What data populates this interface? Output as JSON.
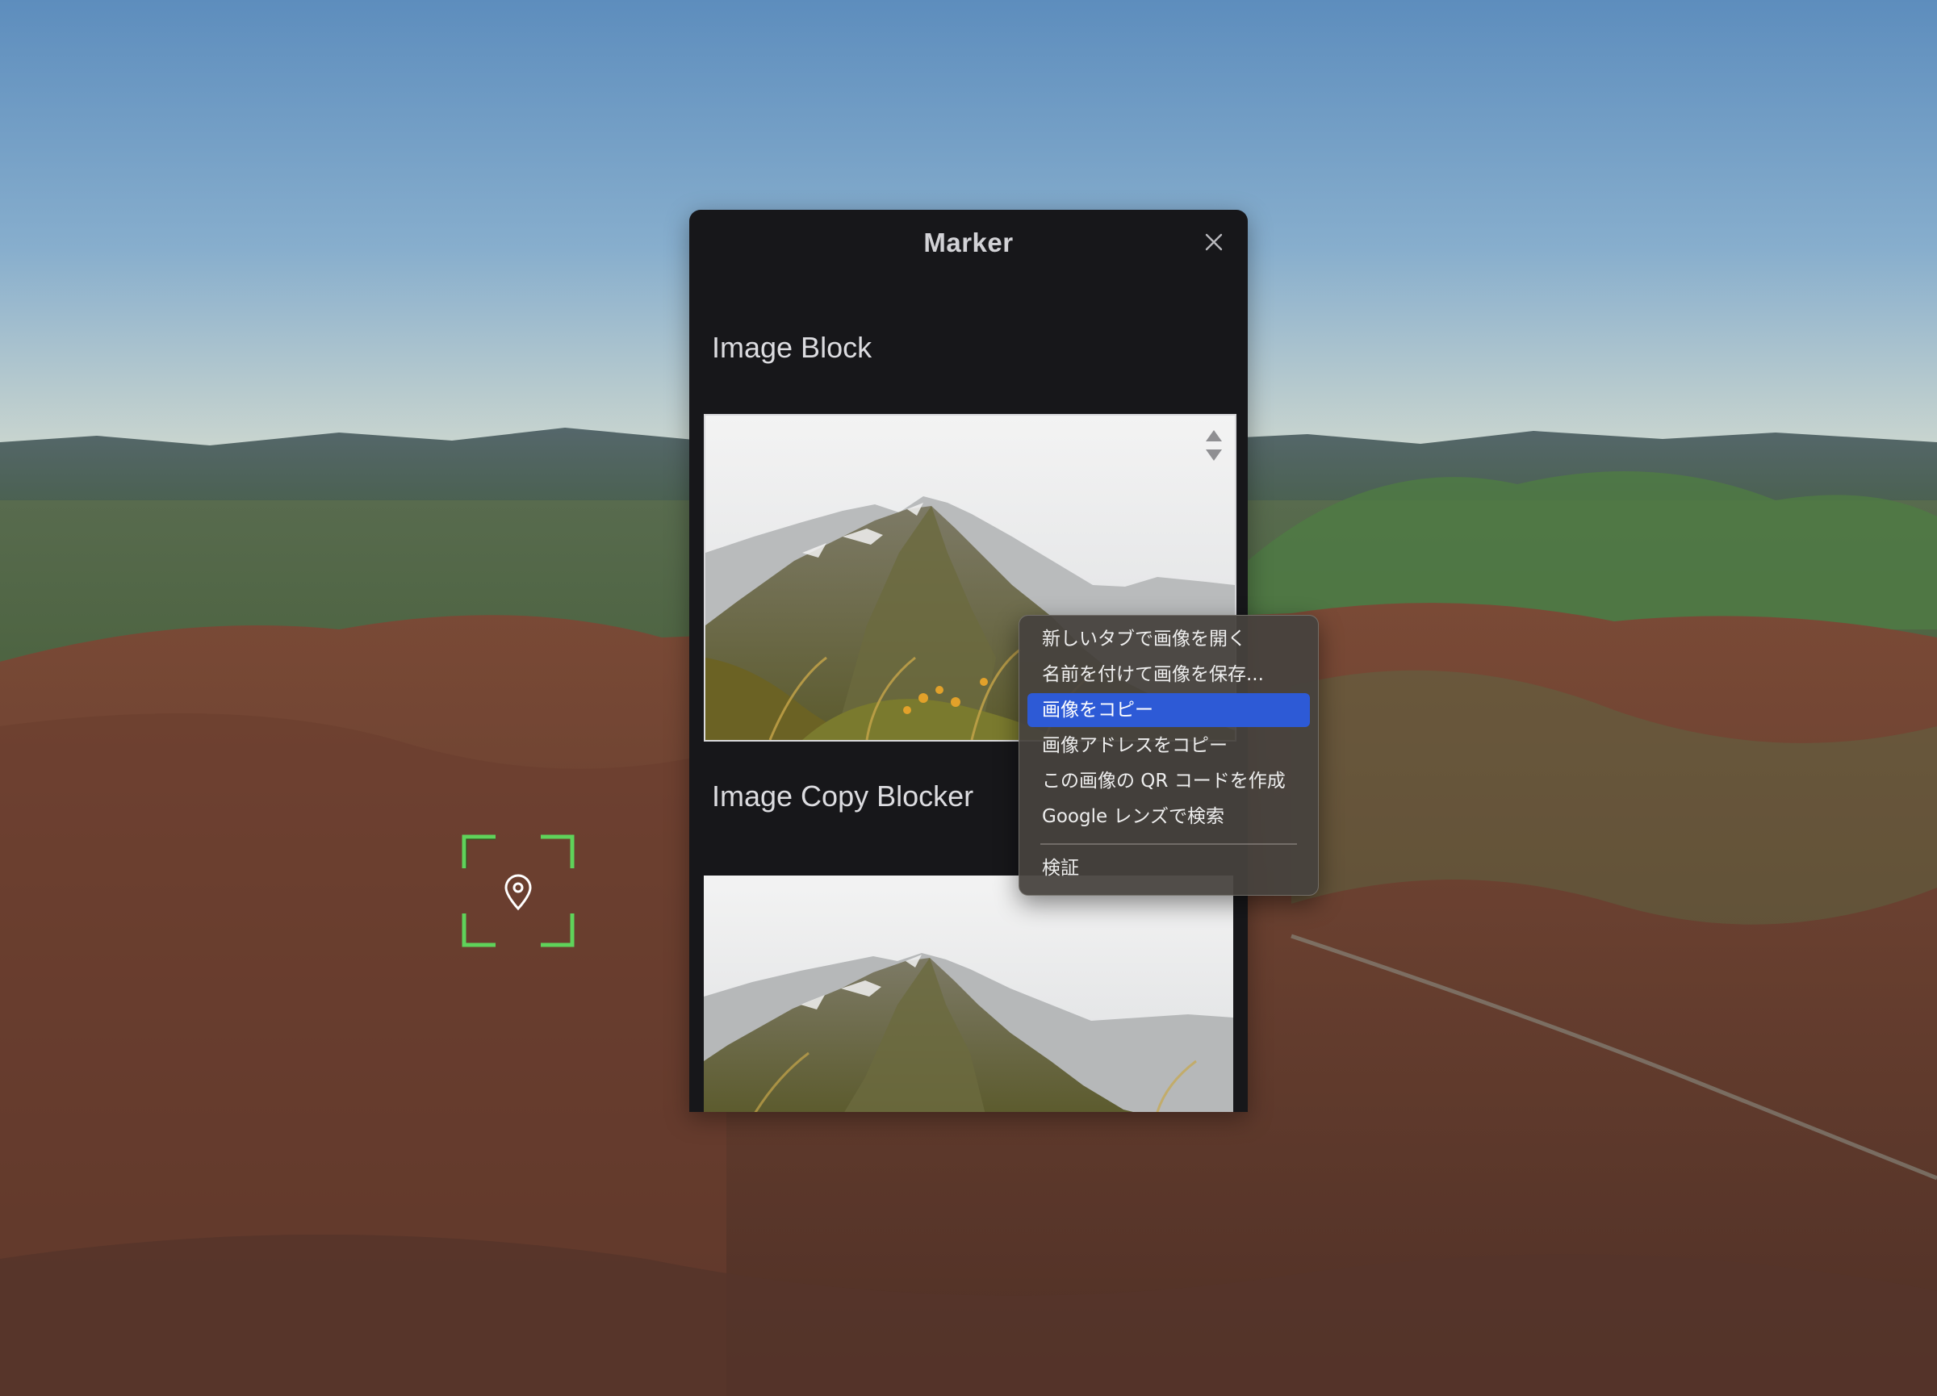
{
  "panel": {
    "title": "Marker",
    "close_icon": "close-icon",
    "sections": [
      {
        "heading": "Image Block"
      },
      {
        "heading": "Image Copy Blocker"
      }
    ]
  },
  "map": {
    "marker_icon": "map-pin-icon",
    "focus_frame_color": "#5fd35a"
  },
  "context_menu": {
    "items": [
      {
        "label": "新しいタブで画像を開く"
      },
      {
        "label": "名前を付けて画像を保存..."
      },
      {
        "label": "画像をコピー",
        "highlighted": true
      },
      {
        "label": "画像アドレスをコピー"
      },
      {
        "label": "この画像の QR コードを作成"
      },
      {
        "label": "Google レンズで検索"
      }
    ],
    "footer_item": {
      "label": "検証"
    },
    "highlight_color": "#2d5ad6"
  }
}
